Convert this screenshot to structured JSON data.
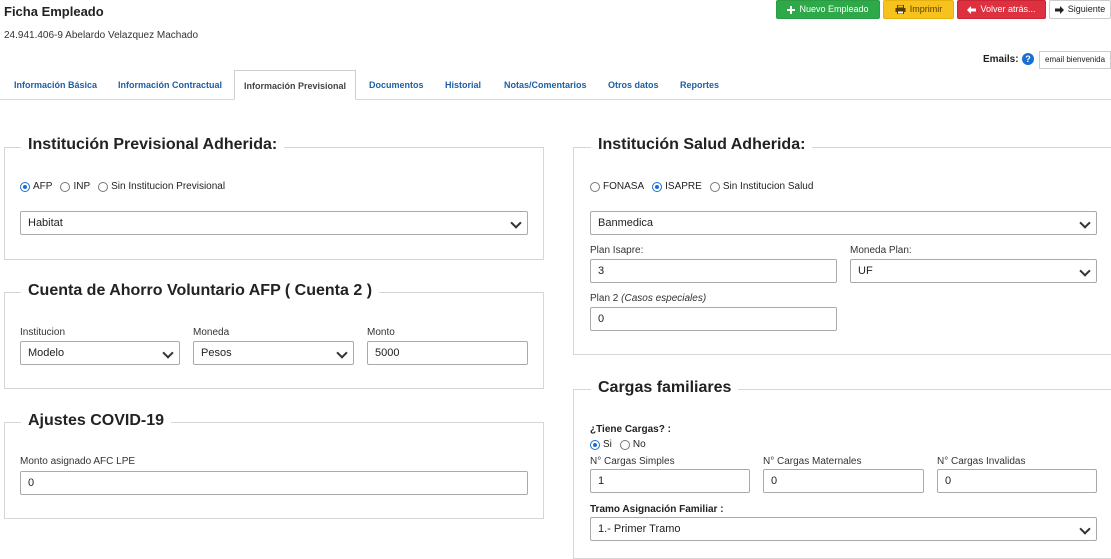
{
  "header": {
    "title": "Ficha Empleado",
    "employee": "24.941.406-9 Abelardo Velazquez Machado"
  },
  "toolbar": {
    "new_label": "Nuevo Empleado",
    "print_label": "Imprimir",
    "back_label": "Volver atrás...",
    "next_label": "Siguiente"
  },
  "emails": {
    "label": "Emails:",
    "help": "?",
    "button": "email bienvenida"
  },
  "tabs": [
    {
      "label": "Información Básica"
    },
    {
      "label": "Información Contractual"
    },
    {
      "label": "Información Previsional"
    },
    {
      "label": "Documentos"
    },
    {
      "label": "Historial"
    },
    {
      "label": "Notas/Comentarios"
    },
    {
      "label": "Otros datos"
    },
    {
      "label": "Reportes"
    }
  ],
  "prevision": {
    "title": "Institución Previsional Adherida:",
    "options": [
      "AFP",
      "INP",
      "Sin Institucion Previsional"
    ],
    "selected_option": "AFP",
    "selected_value": "Habitat"
  },
  "ahorro": {
    "title": "Cuenta de Ahorro Voluntario AFP ( Cuenta 2 )",
    "institucion_label": "Institucion",
    "institucion_value": "Modelo",
    "moneda_label": "Moneda",
    "moneda_value": "Pesos",
    "monto_label": "Monto",
    "monto_value": "5000"
  },
  "covid": {
    "title": "Ajustes COVID-19",
    "monto_label": "Monto asignado AFC LPE",
    "monto_value": "0"
  },
  "salud": {
    "title": "Institución Salud Adherida:",
    "options": [
      "FONASA",
      "ISAPRE",
      "Sin Institucion Salud"
    ],
    "selected_option": "ISAPRE",
    "selected_value": "Banmedica",
    "plan_label": "Plan Isapre:",
    "plan_value": "3",
    "moneda_label": "Moneda Plan:",
    "moneda_value": "UF",
    "plan2_label": "Plan 2",
    "plan2_note": "(Casos especiales)",
    "plan2_value": "0"
  },
  "cargas": {
    "title": "Cargas familiares",
    "question": "¿Tiene Cargas? :",
    "options": [
      "Si",
      "No"
    ],
    "selected_option": "Si",
    "simples_label": "N° Cargas Simples",
    "simples_value": "1",
    "maternales_label": "N° Cargas Maternales",
    "maternales_value": "0",
    "invalidas_label": "N° Cargas Invalidas",
    "invalidas_value": "0",
    "tramo_label": "Tramo Asignación Familiar :",
    "tramo_value": "1.- Primer Tramo"
  },
  "colors": {
    "green": "#2ea94a",
    "yellow": "#f7c21d",
    "red": "#dd3140",
    "link_blue": "#1d5fa6",
    "radio_blue": "#1a6fd1"
  }
}
